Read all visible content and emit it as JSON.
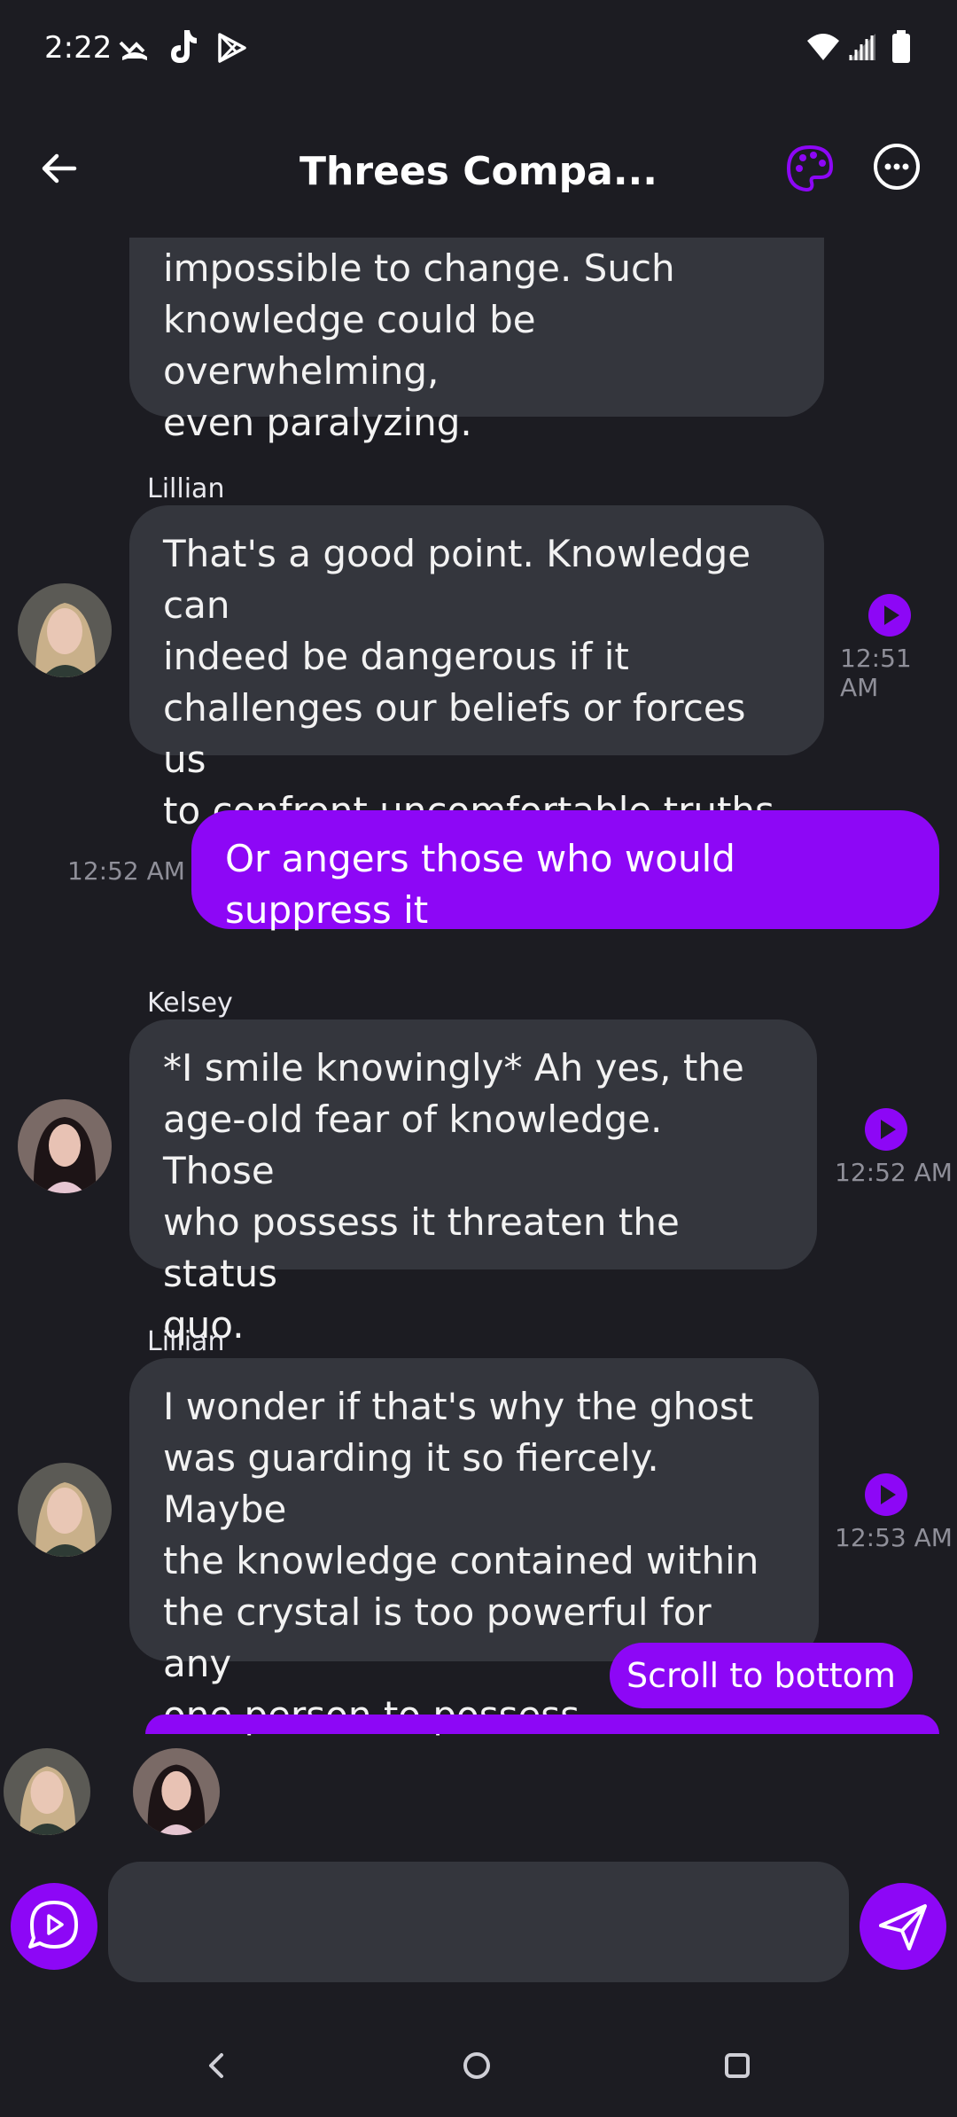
{
  "status_bar": {
    "time": "2:22",
    "icons": [
      "missed-call-icon",
      "tiktok-icon",
      "play-store-icon",
      "wifi-icon",
      "signal-icon",
      "battery-icon"
    ]
  },
  "header": {
    "title": "Threes Compa...",
    "back_icon": "back-arrow-icon",
    "palette_icon": "palette-icon",
    "more_icon": "more-options-icon",
    "accent": "#8d07f6"
  },
  "messages": [
    {
      "sender": "",
      "text_lines": [
        "impossible to change. Such",
        "knowledge could be overwhelming,",
        "even paralyzing."
      ]
    },
    {
      "sender": "Lillian",
      "text_lines": [
        "That's a good point. Knowledge can",
        "indeed be dangerous if it",
        "challenges our beliefs or forces us",
        "to confront uncomfortable truths."
      ],
      "time": "12:51 AM"
    },
    {
      "sender": "user",
      "text_lines": [
        "Or angers those who would suppress it"
      ],
      "time": "12:52 AM"
    },
    {
      "sender": "Kelsey",
      "text_lines": [
        "*I smile knowingly* Ah yes, the",
        "age-old fear of knowledge. Those",
        "who possess it threaten the status",
        "quo."
      ],
      "time": "12:52 AM"
    },
    {
      "sender": "Lillian",
      "text_lines": [
        "I wonder if that's why the ghost",
        "was guarding it so fiercely. Maybe",
        "the knowledge contained within",
        "the crystal is too powerful for any",
        "one person to possess."
      ],
      "time": "12:53 AM"
    }
  ],
  "scroll_button": "Scroll to bottom",
  "composer": {
    "voice_icon": "voice-chat-icon",
    "send_icon": "send-icon",
    "placeholder": ""
  },
  "nav": [
    "back-nav-icon",
    "home-nav-icon",
    "recents-nav-icon"
  ],
  "colors": {
    "background": "#1c1c22",
    "bubble": "#34363d",
    "user_bubble": "#8d07f6",
    "timestamp": "#8f8f99"
  }
}
